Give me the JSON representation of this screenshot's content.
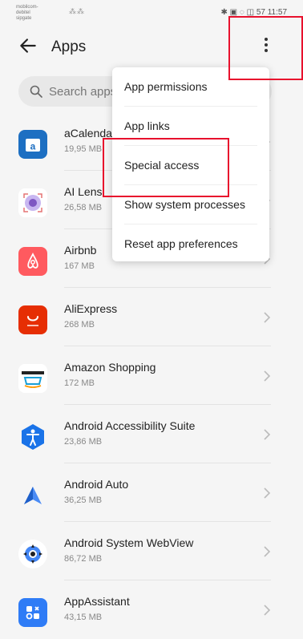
{
  "status": {
    "carrier_line1": "mobilcom-debitel",
    "carrier_line2": "sipgate",
    "signal": "⁂⁂",
    "right": "✱ ▣ ◌ ◫ 57 11:57"
  },
  "appbar": {
    "title": "Apps"
  },
  "search": {
    "placeholder": "Search apps"
  },
  "menu": {
    "items": [
      {
        "label": "App permissions"
      },
      {
        "label": "App links"
      },
      {
        "label": "Special access"
      },
      {
        "label": "Show system processes"
      },
      {
        "label": "Reset app preferences"
      }
    ]
  },
  "apps": [
    {
      "name": "aCalendar",
      "size": "19,95 MB",
      "icon": "acalendar-icon",
      "color": "#1d6fc2"
    },
    {
      "name": "AI Lens",
      "size": "26,58 MB",
      "icon": "ai-lens-icon",
      "color": "#ffffff"
    },
    {
      "name": "Airbnb",
      "size": "167 MB",
      "icon": "airbnb-icon",
      "color": "#ff5a5f"
    },
    {
      "name": "AliExpress",
      "size": "268 MB",
      "icon": "aliexpress-icon",
      "color": "#e62e04"
    },
    {
      "name": "Amazon Shopping",
      "size": "172 MB",
      "icon": "amazon-icon",
      "color": "#ffffff"
    },
    {
      "name": "Android Accessibility Suite",
      "size": "23,86 MB",
      "icon": "accessibility-icon",
      "color": "#1a73e8"
    },
    {
      "name": "Android Auto",
      "size": "36,25 MB",
      "icon": "android-auto-icon",
      "color": "#ffffff"
    },
    {
      "name": "Android System WebView",
      "size": "86,72 MB",
      "icon": "webview-icon",
      "color": "#ffffff"
    },
    {
      "name": "AppAssistant",
      "size": "43,15 MB",
      "icon": "appassistant-icon",
      "color": "#2f7cf6"
    }
  ]
}
